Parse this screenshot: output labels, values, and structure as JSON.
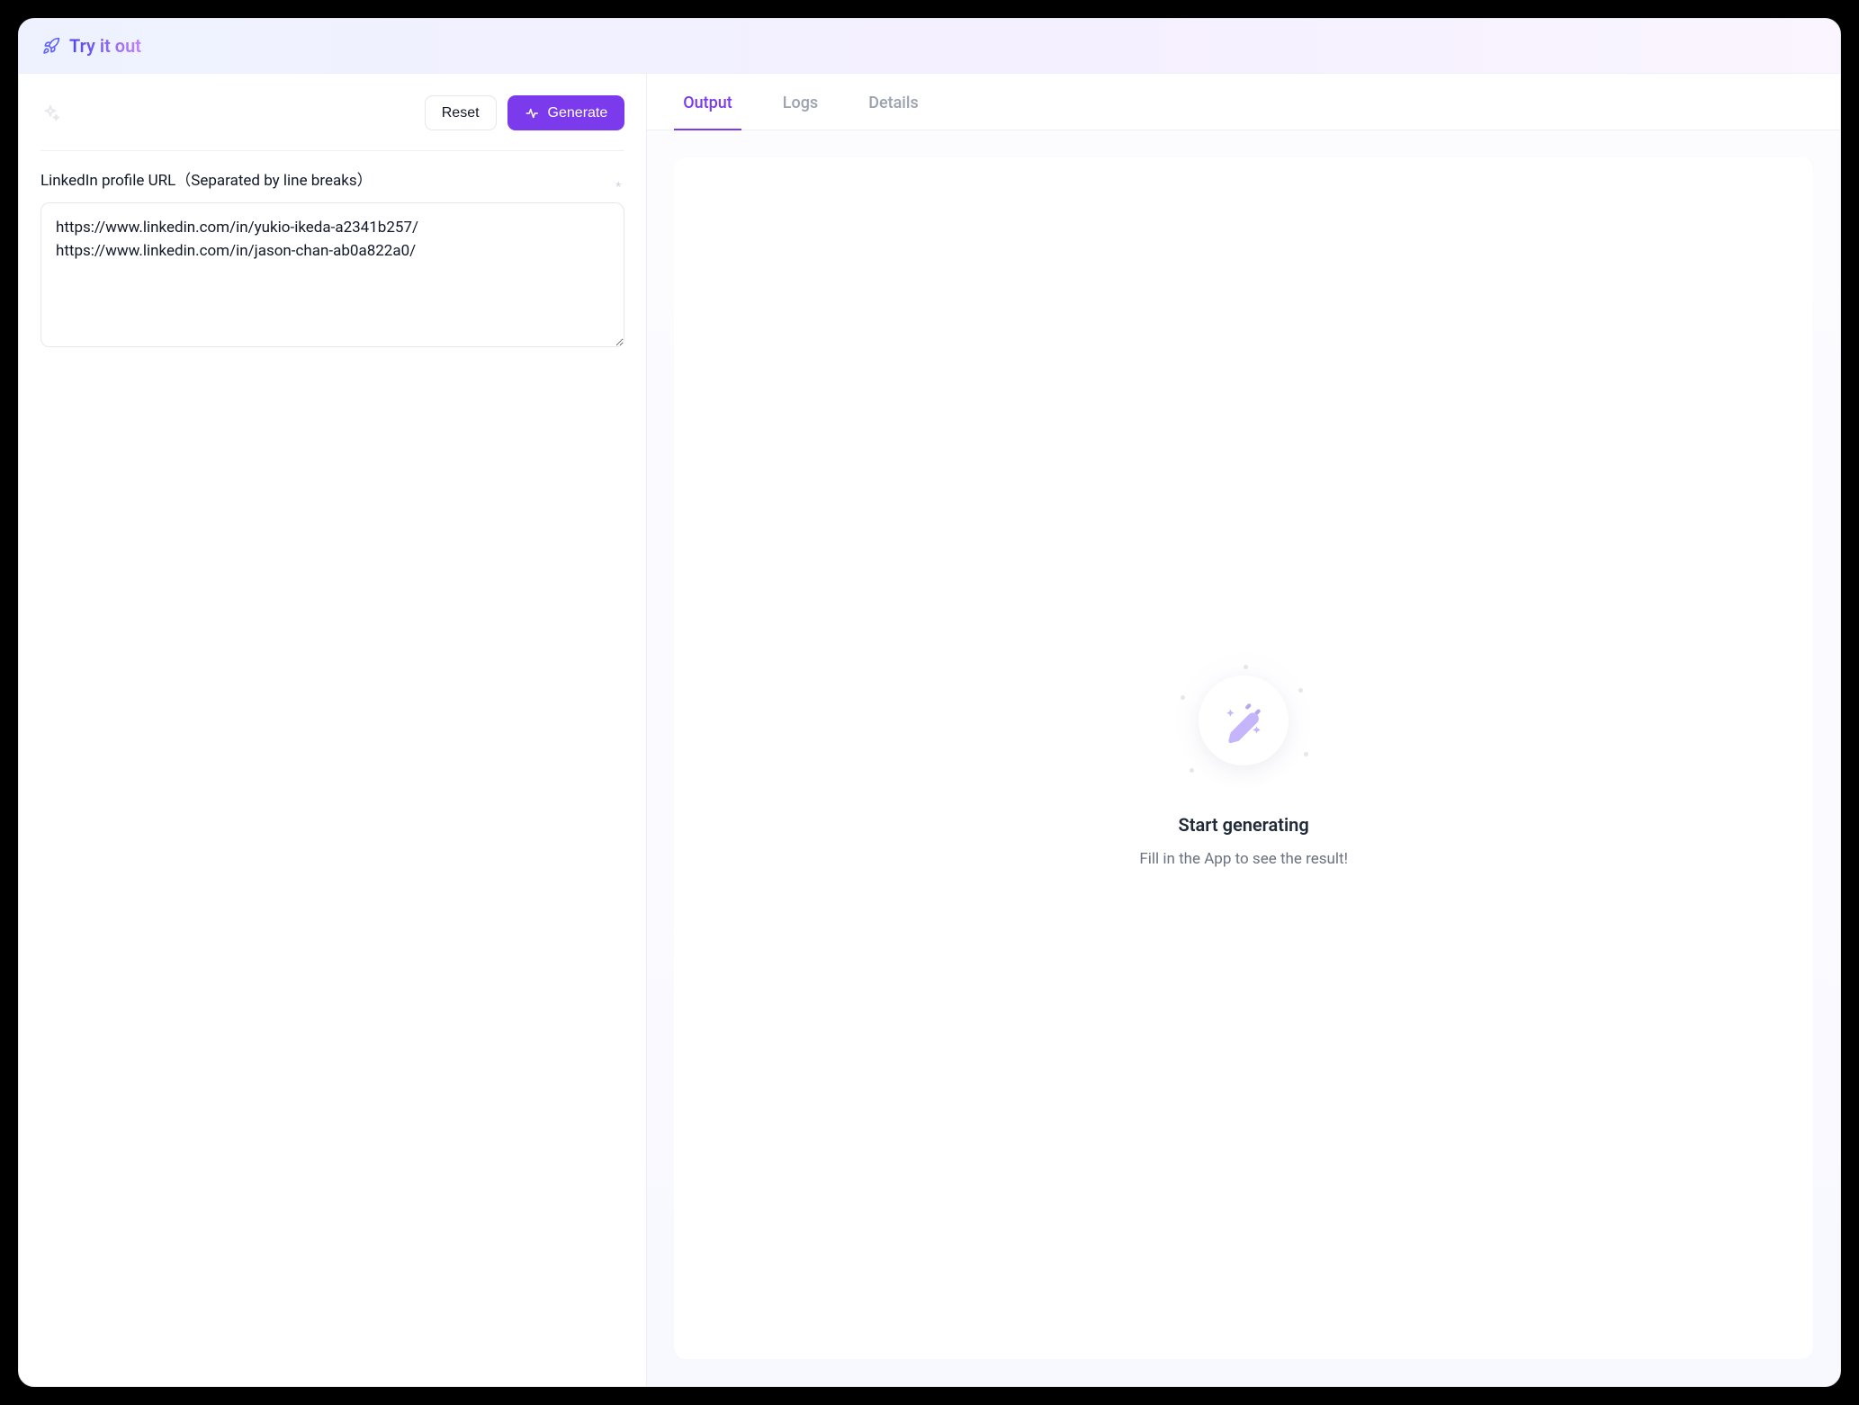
{
  "header": {
    "title": "Try it out"
  },
  "toolbar": {
    "reset_label": "Reset",
    "generate_label": "Generate"
  },
  "form": {
    "linkedin": {
      "label": "LinkedIn profile URL（Separated by line breaks）",
      "value": "https://www.linkedin.com/in/yukio-ikeda-a2341b257/\nhttps://www.linkedin.com/in/jason-chan-ab0a822a0/"
    }
  },
  "tabs": {
    "output": "Output",
    "logs": "Logs",
    "details": "Details",
    "active": "output"
  },
  "empty_state": {
    "title": "Start generating",
    "subtitle": "Fill in the App to see the result!"
  }
}
